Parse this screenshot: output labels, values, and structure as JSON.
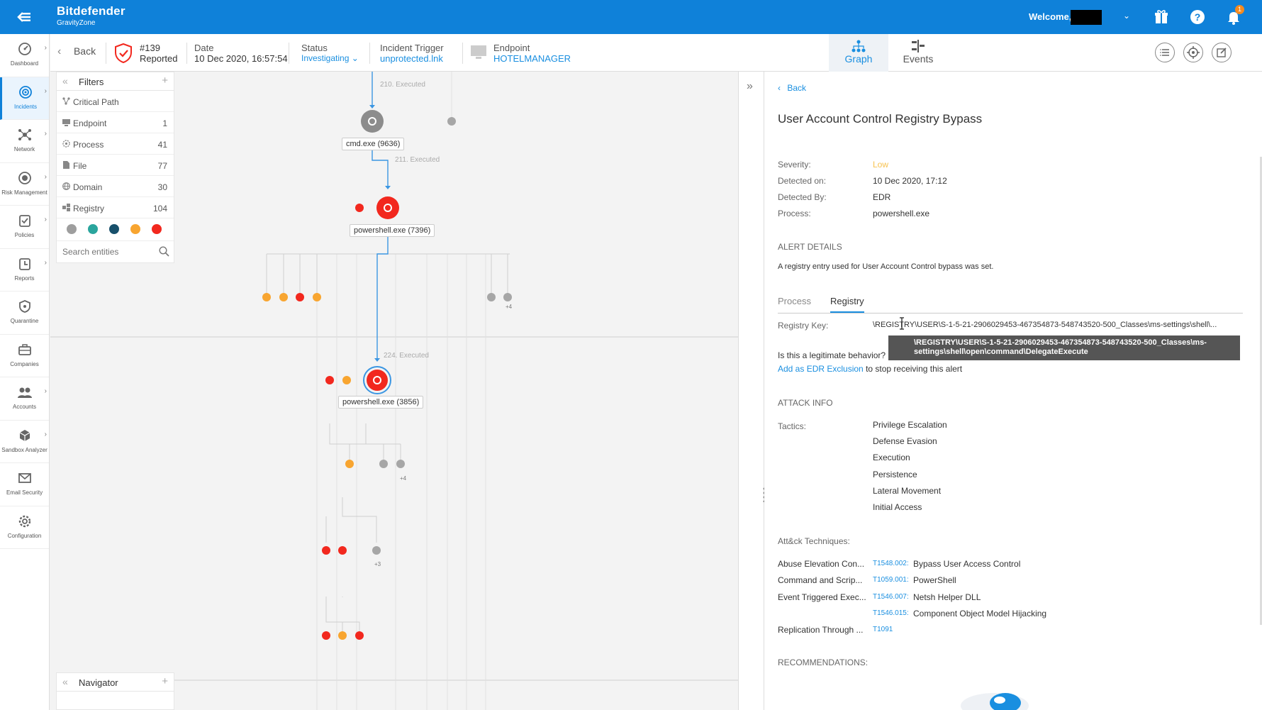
{
  "app": {
    "brand": "Bitdefender",
    "product": "GravityZone",
    "welcome_text": "Welcome,",
    "notification_count": "1"
  },
  "sidebar": {
    "items": [
      {
        "label": "Dashboard",
        "icon": "dashboard-icon",
        "has_arrow": true
      },
      {
        "label": "Incidents",
        "icon": "incidents-icon",
        "has_arrow": true,
        "active": true
      },
      {
        "label": "Network",
        "icon": "network-icon",
        "has_arrow": true
      },
      {
        "label": "Risk Management",
        "icon": "risk-management-icon",
        "has_arrow": true
      },
      {
        "label": "Policies",
        "icon": "policies-icon",
        "has_arrow": true
      },
      {
        "label": "Reports",
        "icon": "reports-icon",
        "has_arrow": true
      },
      {
        "label": "Quarantine",
        "icon": "quarantine-icon",
        "has_arrow": false
      },
      {
        "label": "Companies",
        "icon": "companies-icon",
        "has_arrow": false
      },
      {
        "label": "Accounts",
        "icon": "accounts-icon",
        "has_arrow": true
      },
      {
        "label": "Sandbox Analyzer",
        "icon": "sandbox-icon",
        "has_arrow": true
      },
      {
        "label": "Email Security",
        "icon": "email-security-icon",
        "has_arrow": false
      },
      {
        "label": "Configuration",
        "icon": "configuration-icon",
        "has_arrow": false
      }
    ]
  },
  "incident": {
    "back_label": "Back",
    "number": "#139",
    "state": "Reported",
    "date_label": "Date",
    "date_value": "10 Dec 2020, 16:57:54",
    "status_label": "Status",
    "status_value": "Investigating",
    "trigger_label": "Incident Trigger",
    "trigger_value": "unprotected.lnk",
    "endpoint_label": "Endpoint",
    "endpoint_value": "HOTELMANAGER",
    "view_tabs": [
      "Graph",
      "Events"
    ],
    "active_view": "Graph"
  },
  "filters": {
    "title": "Filters",
    "rows": [
      {
        "label": "Critical Path",
        "count": "",
        "icon": "critical-path-icon"
      },
      {
        "label": "Endpoint",
        "count": "1",
        "icon": "endpoint-icon"
      },
      {
        "label": "Process",
        "count": "41",
        "icon": "process-icon"
      },
      {
        "label": "File",
        "count": "77",
        "icon": "file-icon"
      },
      {
        "label": "Domain",
        "count": "30",
        "icon": "domain-icon"
      },
      {
        "label": "Registry",
        "count": "104",
        "icon": "registry-icon"
      }
    ],
    "severity_colors": [
      "#9e9e9e",
      "#2aa59d",
      "#17506b",
      "#f8a530",
      "#f2281e"
    ],
    "search_placeholder": "Search entities"
  },
  "navigator": {
    "title": "Navigator"
  },
  "graph": {
    "edge_labels": [
      "210. Executed",
      "211. Executed",
      "224. Executed"
    ],
    "nodes": [
      "cmd.exe (9636)",
      "powershell.exe (7396)",
      "powershell.exe (3856)"
    ],
    "more_counts": [
      "+4",
      "+4",
      "+3"
    ],
    "colors": {
      "gray": "#a6a6a6",
      "orange": "#f8a530",
      "red": "#f2281e",
      "blue": "#3b96e2"
    }
  },
  "detail": {
    "back_label": "Back",
    "title": "User Account Control Registry Bypass",
    "fields": [
      {
        "key": "Severity:",
        "value": "Low",
        "color": "#f7c24f"
      },
      {
        "key": "Detected on:",
        "value": "10 Dec 2020, 17:12"
      },
      {
        "key": "Detected By:",
        "value": "EDR"
      },
      {
        "key": "Process:",
        "value": "powershell.exe"
      }
    ],
    "alert_details_heading": "ALERT DETAILS",
    "alert_description": "A registry entry used for User Account Control bypass was set.",
    "tabs": [
      "Process",
      "Registry"
    ],
    "active_tab": "Registry",
    "registry_key_label": "Registry Key:",
    "registry_key_value": "\\REGISTRY\\USER\\S-1-5-21-2906029453-467354873-548743520-500_Classes\\ms-settings\\shell\\...",
    "tooltip_line1": "\\REGISTRY\\USER\\S-1-5-21-2906029453-467354873-548743520-500_Classes\\ms-",
    "tooltip_line2": "settings\\shell\\open\\command\\DelegateExecute",
    "legit_question": "Is this a legitimate behavior?",
    "exclusion_link": "Add as EDR Exclusion",
    "exclusion_suffix": " to stop receiving this alert",
    "attack_info_heading": "ATTACK INFO",
    "tactics_label": "Tactics:",
    "tactics": [
      "Privilege Escalation",
      "Defense Evasion",
      "Execution",
      "Persistence",
      "Lateral Movement",
      "Initial Access"
    ],
    "techniques_heading": "Att&ck Techniques:",
    "techniques": [
      {
        "category": "Abuse Elevation Con...",
        "id": "T1548.002:",
        "name": "Bypass User Access Control"
      },
      {
        "category": "Command and Scrip...",
        "id": "T1059.001:",
        "name": "PowerShell"
      },
      {
        "category": "Event Triggered Exec...",
        "id": "T1546.007:",
        "name": "Netsh Helper DLL"
      },
      {
        "category": "",
        "id": "T1546.015:",
        "name": "Component Object Model Hijacking"
      },
      {
        "category": "Replication Through ...",
        "id": "T1091",
        "name": ""
      }
    ],
    "recommendations_heading": "RECOMMENDATIONS:"
  }
}
